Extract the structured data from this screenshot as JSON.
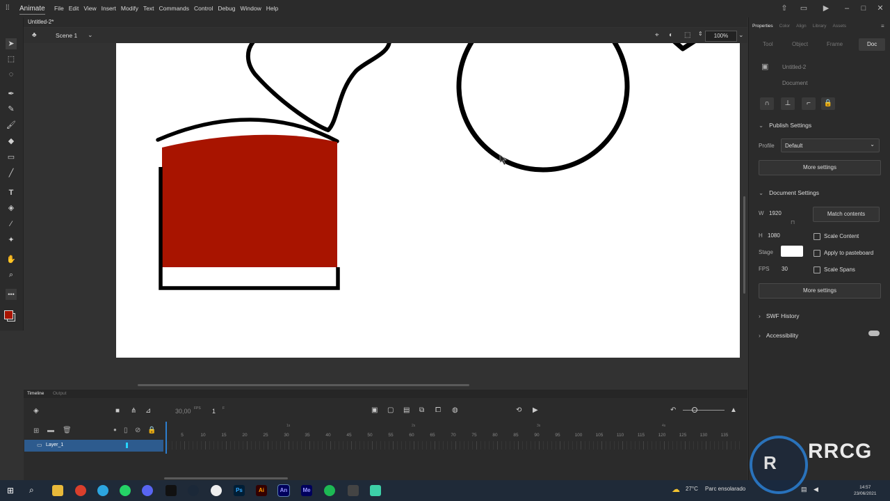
{
  "app": {
    "name": "Animate"
  },
  "menu": [
    "File",
    "Edit",
    "View",
    "Insert",
    "Modify",
    "Text",
    "Commands",
    "Control",
    "Debug",
    "Window",
    "Help"
  ],
  "document_tab": "Untitled-2*",
  "scene": {
    "label": "Scene 1",
    "zoom": "100%"
  },
  "panel": {
    "tabs": [
      "Properties",
      "Color",
      "Align",
      "Library",
      "Assets"
    ],
    "active_tab": "Properties",
    "subtabs": [
      "Tool",
      "Object",
      "Frame",
      "Doc"
    ],
    "active_subtab": "Doc",
    "doc_name": "Untitled-2",
    "doc_type": "Document",
    "publish": {
      "title": "Publish Settings",
      "profile_label": "Profile",
      "profile_value": "Default",
      "more": "More settings"
    },
    "doc_settings": {
      "title": "Document Settings",
      "w_label": "W",
      "w_value": "1920",
      "h_label": "H",
      "h_value": "1080",
      "match": "Match contents",
      "scale_content": "Scale Content",
      "stage_label": "Stage",
      "stage_color": "#ffffff",
      "apply_pasteboard": "Apply to pasteboard",
      "fps_label": "FPS",
      "fps_value": "30",
      "scale_spans": "Scale Spans",
      "more": "More settings"
    },
    "swf_history": "SWF History",
    "accessibility": "Accessibility"
  },
  "timeline": {
    "tabs": [
      "Timeline",
      "Output"
    ],
    "fps": "30,00",
    "fps_unit": "FPS",
    "frame": "1",
    "frame_unit": "F",
    "layer_name": "Layer_1",
    "frame_numbers": [
      "5",
      "10",
      "15",
      "20",
      "25",
      "30",
      "35",
      "40",
      "45",
      "50",
      "55",
      "60",
      "65",
      "70",
      "75",
      "80",
      "85",
      "90",
      "95",
      "100",
      "105",
      "110",
      "115",
      "120",
      "125",
      "130",
      "135"
    ],
    "seconds": [
      "1s",
      "2s",
      "3s",
      "4s"
    ]
  },
  "colors": {
    "fill": "#a81400",
    "stroke": "#000000",
    "accent": "#2d5b8e"
  },
  "taskbar": {
    "apps": [
      "Ps",
      "Ai",
      "An",
      "Me"
    ],
    "weather": "27°C",
    "weather_text": "Parc ensolarado",
    "time": "14:57",
    "date": "23/06/2021"
  },
  "watermark": "RRCG"
}
